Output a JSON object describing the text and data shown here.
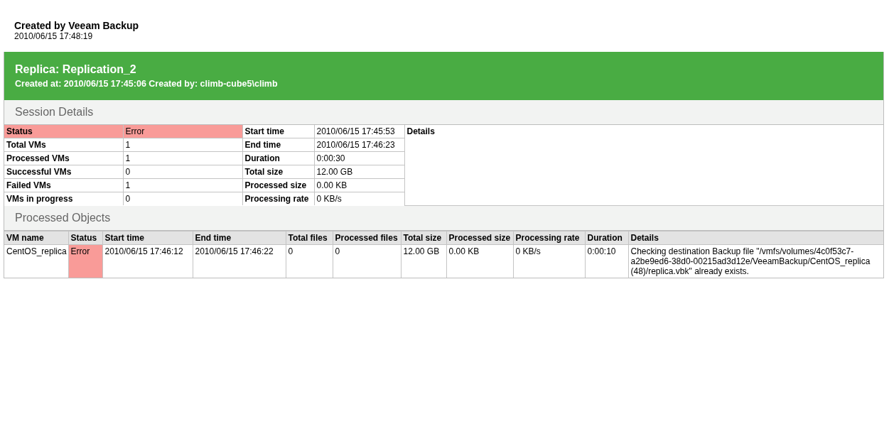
{
  "report": {
    "title": "Created by Veeam Backup",
    "timestamp": "2010/06/15 17:48:19"
  },
  "job": {
    "title": "Replica: Replication_2",
    "subtitle": "Created at: 2010/06/15 17:45:06 Created by: climb-cube5\\climb"
  },
  "session_details": {
    "heading": "Session Details",
    "details_label": "Details",
    "rows": [
      {
        "label": "Status",
        "value": "Error",
        "error": true,
        "label_2": "Start time",
        "value_2": "2010/06/15 17:45:53"
      },
      {
        "label": "Total VMs",
        "value": "1",
        "error": false,
        "label_2": "End time",
        "value_2": "2010/06/15 17:46:23"
      },
      {
        "label": "Processed VMs",
        "value": "1",
        "error": false,
        "label_2": "Duration",
        "value_2": "0:00:30"
      },
      {
        "label": "Successful VMs",
        "value": "0",
        "error": false,
        "label_2": "Total size",
        "value_2": "12.00 GB"
      },
      {
        "label": "Failed VMs",
        "value": "1",
        "error": false,
        "label_2": "Processed size",
        "value_2": "0.00 KB"
      },
      {
        "label": "VMs in progress",
        "value": "0",
        "error": false,
        "label_2": "Processing rate",
        "value_2": "0 KB/s"
      }
    ]
  },
  "processed_objects": {
    "heading": "Processed Objects",
    "columns": [
      "VM name",
      "Status",
      "Start time",
      "End time",
      "Total files",
      "Processed files",
      "Total size",
      "Processed size",
      "Processing rate",
      "Duration",
      "Details"
    ],
    "rows": [
      {
        "error": true,
        "cells": [
          "CentOS_replica",
          "Error",
          "2010/06/15 17:46:12",
          "2010/06/15 17:46:22",
          "0",
          "0",
          "12.00 GB",
          "0.00 KB",
          "0 KB/s",
          "0:00:10",
          "Checking destination Backup file \"/vmfs/volumes/4c0f53c7-a2be9ed6-38d0-00215ad3d12e/VeeamBackup/CentOS_replica (48)/replica.vbk\" already exists."
        ]
      }
    ]
  }
}
